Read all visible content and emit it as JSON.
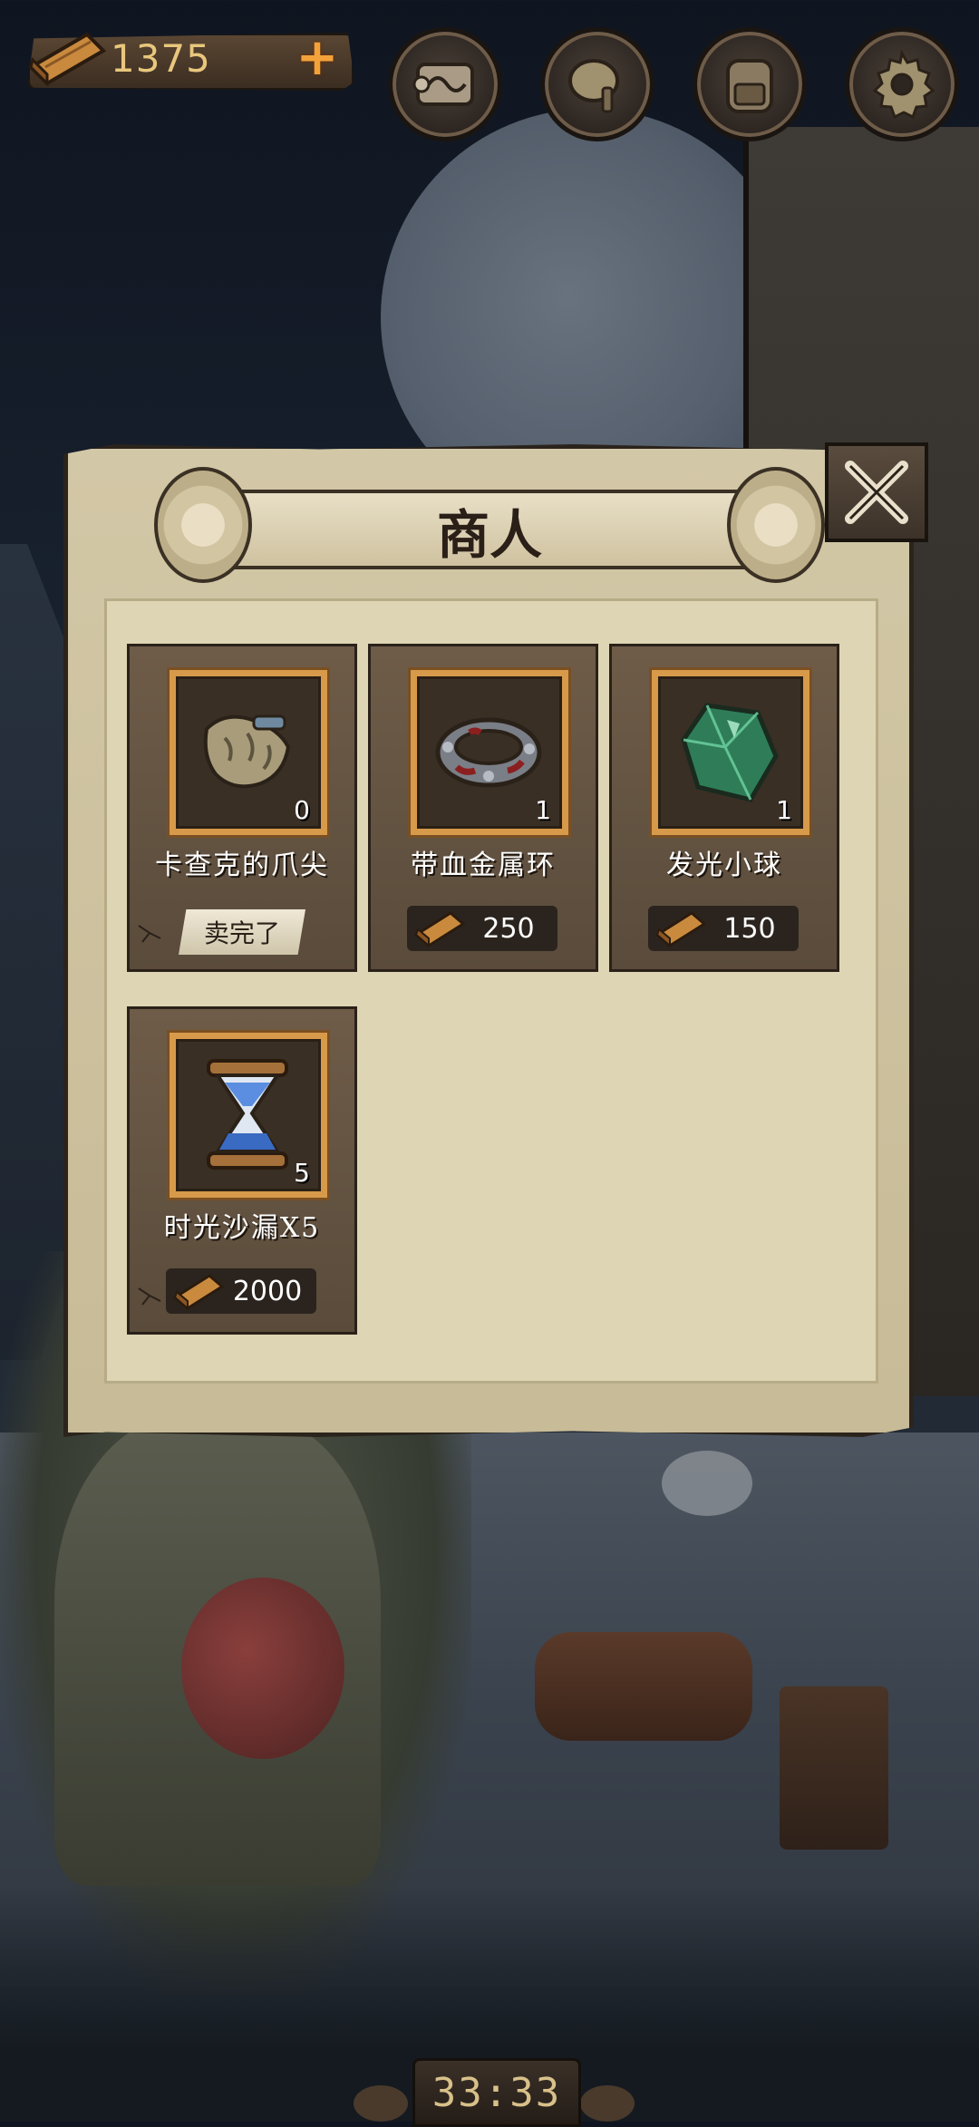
{
  "hud": {
    "currency_amount": "1375",
    "add_label": "+",
    "buttons": [
      {
        "name": "map-scroll-icon"
      },
      {
        "name": "bell-icon"
      },
      {
        "name": "backpack-icon"
      },
      {
        "name": "gear-icon"
      }
    ]
  },
  "panel": {
    "title": "商人",
    "items": [
      {
        "name": "卡查克的爪尖",
        "quantity": "0",
        "status": "卖完了",
        "icon": "claw-icon"
      },
      {
        "name": "带血金属环",
        "quantity": "1",
        "price": "250",
        "icon": "bloody-ring-icon"
      },
      {
        "name": "发光小球",
        "quantity": "1",
        "price": "150",
        "icon": "green-crystal-icon"
      },
      {
        "name": "时光沙漏X5",
        "quantity": "5",
        "price": "2000",
        "icon": "hourglass-icon"
      }
    ]
  },
  "timer": "33:33",
  "colors": {
    "currency_text": "#e8c77d",
    "plus": "#f2a23a",
    "frame": "#d79a4a",
    "panel": "#d2c7a6"
  }
}
